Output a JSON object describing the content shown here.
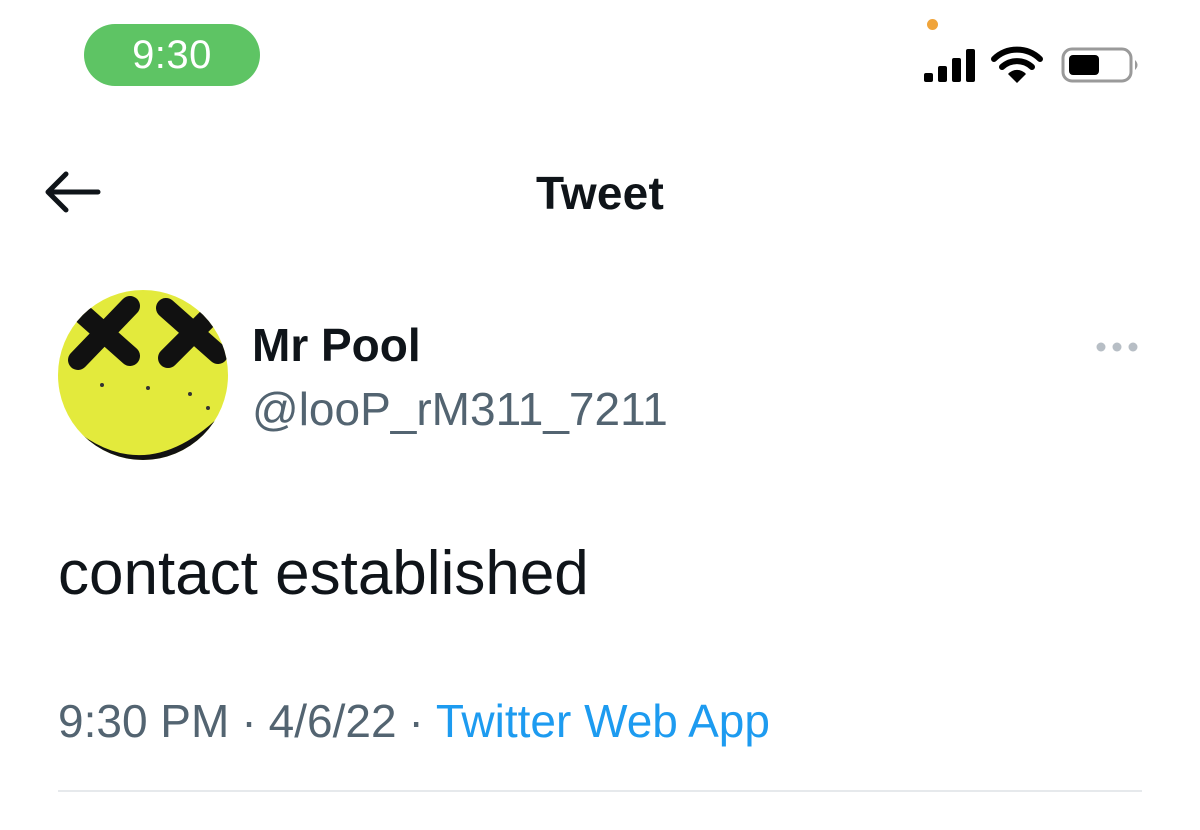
{
  "status_bar": {
    "time": "9:30",
    "time_pill_color": "#5ec464",
    "privacy_dot_color": "#f0a43a",
    "icons": [
      "signal-icon",
      "wifi-icon",
      "battery-icon"
    ]
  },
  "header": {
    "title": "Tweet",
    "back_icon": "arrow-left-icon"
  },
  "tweet": {
    "author": {
      "name": "Mr Pool",
      "handle": "@looP_rM311_7211",
      "avatar": "yellow-smiley-x-eyes"
    },
    "text": "contact established",
    "time": "9:30 PM",
    "separator": "·",
    "date": "4/6/22",
    "source": "Twitter Web App",
    "more_icon": "more-horizontal-icon"
  },
  "colors": {
    "text_primary": "#0f1419",
    "text_secondary": "#536471",
    "link": "#1d9bf0",
    "avatar_yellow": "#e3ea3c",
    "divider": "#e6e9ec"
  }
}
